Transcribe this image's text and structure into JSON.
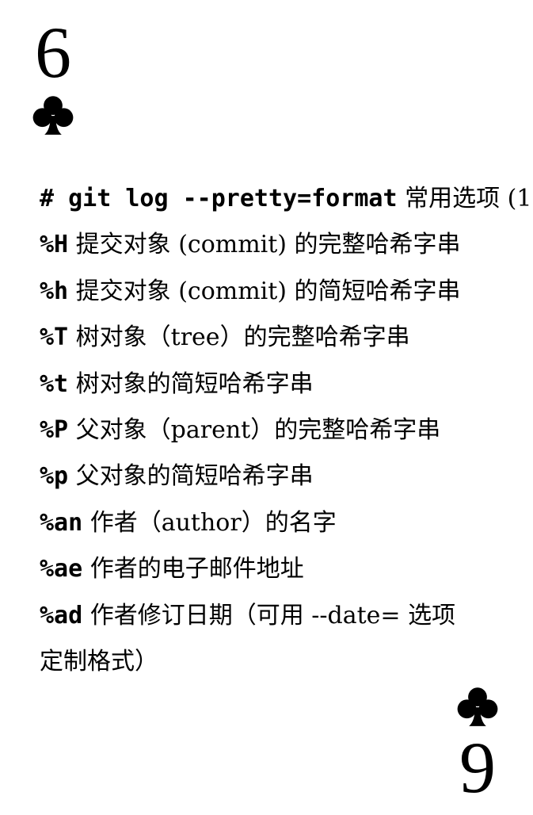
{
  "card": {
    "rank_top": "6",
    "rank_bottom": "9",
    "suit": "club-icon",
    "suit_color": "#000000",
    "background": "#ffffff"
  },
  "lines": [
    {
      "code": "# git log --pretty=format",
      "text": " 常用选项 (1"
    },
    {
      "code": "%H",
      "text": " 提交对象 (commit) 的完整哈希字串"
    },
    {
      "code": "%h",
      "text": " 提交对象 (commit) 的简短哈希字串"
    },
    {
      "code": "%T",
      "text": " 树对象（tree）的完整哈希字串"
    },
    {
      "code": "%t",
      "text": " 树对象的简短哈希字串"
    },
    {
      "code": "%P",
      "text": " 父对象（parent）的完整哈希字串"
    },
    {
      "code": "%p",
      "text": "  父对象的简短哈希字串"
    },
    {
      "code": "%an",
      "text": " 作者（author）的名字"
    },
    {
      "code": "%ae",
      "text": " 作者的电子邮件地址"
    },
    {
      "code": "%ad",
      "text": " 作者修订日期（可用 --date= 选项"
    },
    {
      "code": "",
      "text": "定制格式）"
    }
  ]
}
